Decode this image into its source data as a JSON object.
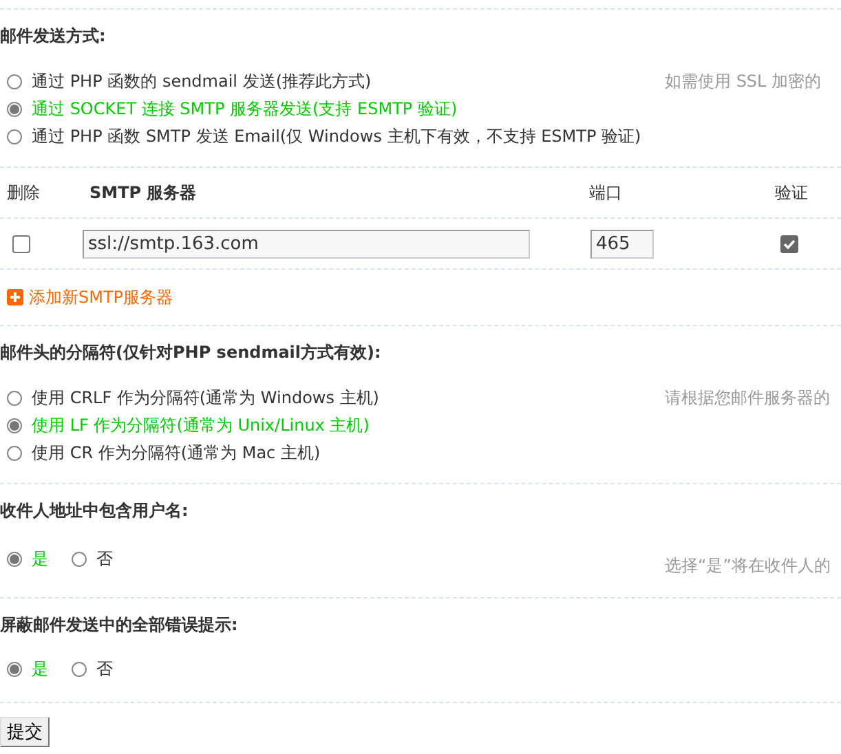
{
  "sections": [
    {
      "kind": "stacked",
      "title": "邮件发送方式:",
      "options": [
        {
          "label": "通过 PHP 函数的 sendmail 发送(推荐此方式)",
          "selected": false
        },
        {
          "label": "通过 SOCKET 连接 SMTP 服务器发送(支持 ESMTP 验证)",
          "selected": true
        },
        {
          "label": "通过 PHP 函数 SMTP 发送 Email(仅 Windows 主机下有效，不支持 ESMTP 验证)",
          "selected": false
        }
      ],
      "tip": "如需使用 SSL 加密的"
    },
    {
      "kind": "table",
      "columns": [
        "删除",
        "SMTP 服务器",
        "端口",
        "验证"
      ],
      "rows": [
        {
          "delete": false,
          "server": "ssl://smtp.163.com",
          "port": "465",
          "auth": true
        }
      ],
      "add_link": "添加新SMTP服务器"
    },
    {
      "kind": "stacked",
      "title": "邮件头的分隔符(仅针对PHP sendmail方式有效):",
      "options": [
        {
          "label": "使用 CRLF 作为分隔符(通常为 Windows 主机)",
          "selected": false
        },
        {
          "label": "使用 LF 作为分隔符(通常为 Unix/Linux 主机)",
          "selected": true
        },
        {
          "label": "使用 CR 作为分隔符(通常为 Mac 主机)",
          "selected": false
        }
      ],
      "tip": "请根据您邮件服务器的"
    },
    {
      "kind": "inline",
      "title": "收件人地址中包含用户名:",
      "options": [
        {
          "label": "是",
          "selected": true
        },
        {
          "label": "否",
          "selected": false
        }
      ],
      "tip": "选择“是”将在收件人的"
    },
    {
      "kind": "inline",
      "title": "屏蔽邮件发送中的全部错误提示:",
      "options": [
        {
          "label": "是",
          "selected": true
        },
        {
          "label": "否",
          "selected": false
        }
      ]
    }
  ],
  "submit_button": "提交"
}
